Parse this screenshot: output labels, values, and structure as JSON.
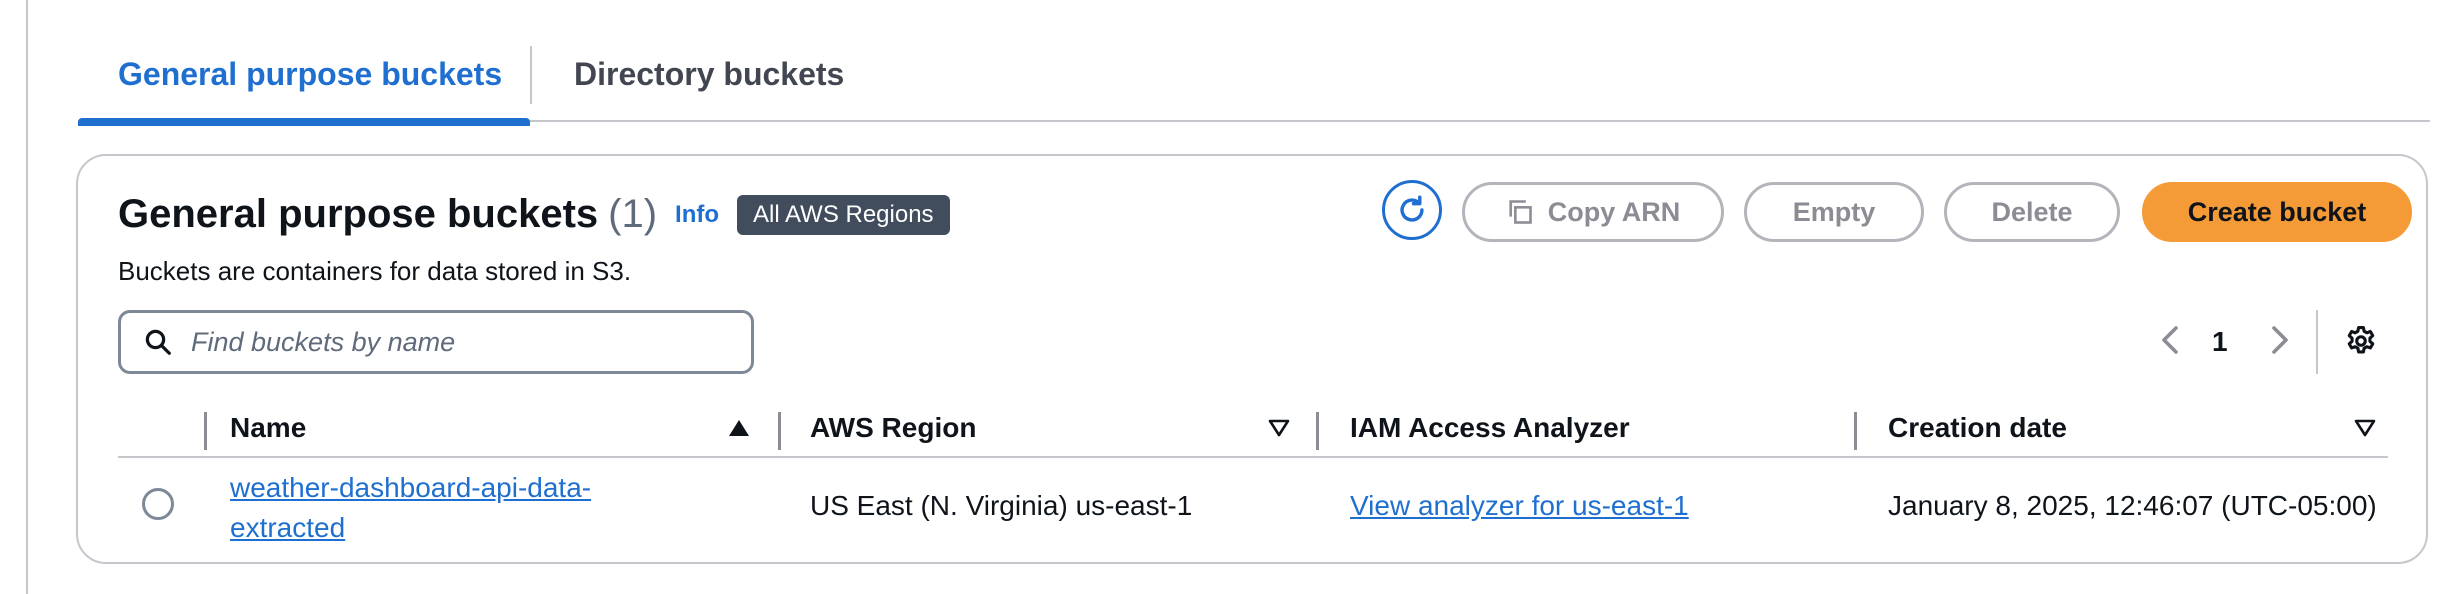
{
  "tabs": [
    {
      "label": "General purpose buckets",
      "active": true
    },
    {
      "label": "Directory buckets",
      "active": false
    }
  ],
  "panel": {
    "title": "General purpose buckets",
    "count": "(1)",
    "info_label": "Info",
    "region_badge": "All AWS Regions",
    "description": "Buckets are containers for data stored in S3."
  },
  "toolbar": {
    "refresh_icon": "refresh-icon",
    "copy_arn_label": "Copy ARN",
    "empty_label": "Empty",
    "delete_label": "Delete",
    "create_label": "Create bucket"
  },
  "search": {
    "placeholder": "Find buckets by name",
    "value": ""
  },
  "pagination": {
    "current_page": "1"
  },
  "table": {
    "columns": [
      "Name",
      "AWS Region",
      "IAM Access Analyzer",
      "Creation date"
    ],
    "rows": [
      {
        "name": "weather-dashboard-api-data-extracted",
        "region": "US East (N. Virginia) us-east-1",
        "analyzer": "View analyzer for us-east-1",
        "created": "January 8, 2025, 12:46:07 (UTC-05:00)"
      }
    ]
  },
  "colors": {
    "accent": "#1f6fd1",
    "primary_button": "#f49a37",
    "badge": "#414d5c"
  }
}
